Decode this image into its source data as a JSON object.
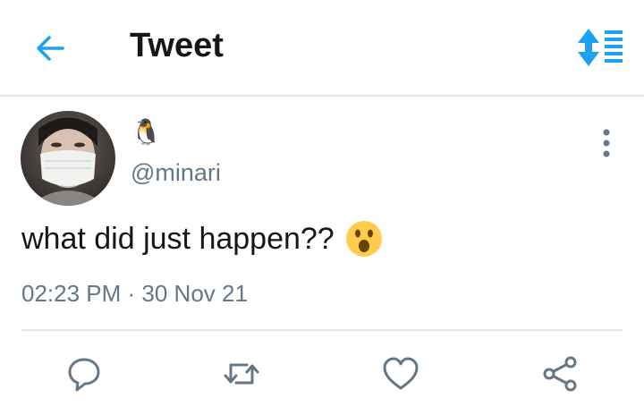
{
  "header": {
    "title": "Tweet",
    "back_icon": "arrow-left-icon",
    "sort_icon": "sort-arrows-icon",
    "accent_color": "#1da1f2"
  },
  "tweet": {
    "display_name": "🐧",
    "handle": "@minari",
    "text": "what did just happen??",
    "emoji": "astonished-face",
    "time": "02:23 PM",
    "separator": " · ",
    "date": "30 Nov 21"
  },
  "actions": {
    "reply_icon": "reply-icon",
    "retweet_icon": "retweet-icon",
    "like_icon": "heart-icon",
    "share_icon": "share-icon"
  },
  "colors": {
    "text": "#14171a",
    "secondary": "#657786",
    "divider": "#e1e8ed",
    "icon": "#657786"
  }
}
